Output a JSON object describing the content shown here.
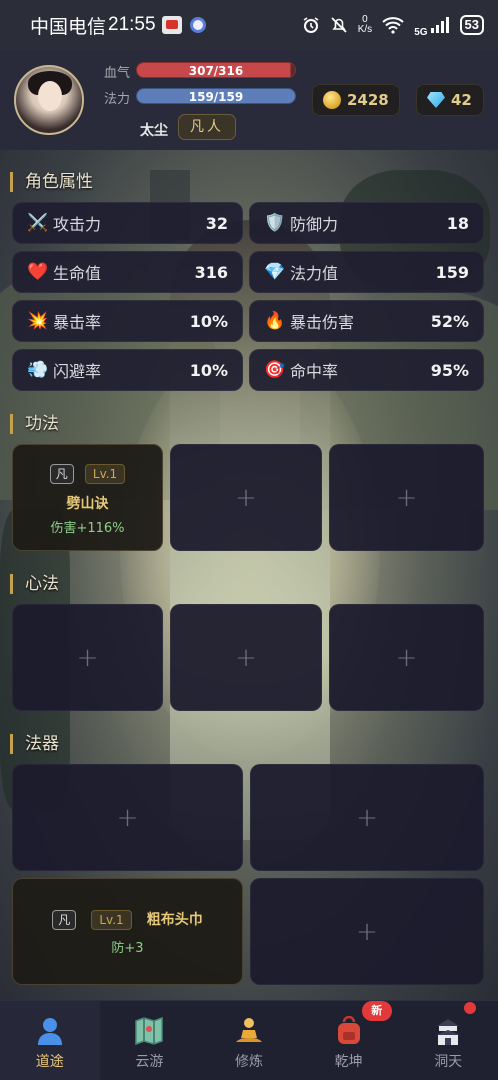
{
  "status_bar": {
    "carrier": "中国电信",
    "time": "21:55",
    "net_speed_value": "0",
    "net_speed_unit": "K/s",
    "signal_type": "5G",
    "battery": "53"
  },
  "header": {
    "hp_label": "血气",
    "hp_value": "307/316",
    "hp_fraction": 0.9715,
    "mp_label": "法力",
    "mp_value": "159/159",
    "mp_fraction": 1.0,
    "player_name": "太尘",
    "rank": "凡人",
    "gold": "2428",
    "gems": "42"
  },
  "attributes": {
    "title": "角色属性",
    "items": [
      {
        "icon": "⚔️",
        "icon_name": "swords-icon",
        "label": "攻击力",
        "value": "32"
      },
      {
        "icon": "🛡️",
        "icon_name": "shield-icon",
        "label": "防御力",
        "value": "18"
      },
      {
        "icon": "❤️",
        "icon_name": "heart-icon",
        "label": "生命值",
        "value": "316"
      },
      {
        "icon": "💎",
        "icon_name": "diamond-icon",
        "label": "法力值",
        "value": "159"
      },
      {
        "icon": "💥",
        "icon_name": "explosion-icon",
        "label": "暴击率",
        "value": "10%"
      },
      {
        "icon": "🔥",
        "icon_name": "fire-icon",
        "label": "暴击伤害",
        "value": "52%"
      },
      {
        "icon": "💨",
        "icon_name": "wind-icon",
        "label": "闪避率",
        "value": "10%"
      },
      {
        "icon": "🎯",
        "icon_name": "target-icon",
        "label": "命中率",
        "value": "95%"
      }
    ]
  },
  "skills": {
    "title": "功法",
    "slot1": {
      "grade": "凡",
      "level": "Lv.1",
      "name": "劈山诀",
      "effect": "伤害+116%"
    }
  },
  "mind": {
    "title": "心法"
  },
  "artifacts": {
    "title": "法器",
    "slot3": {
      "grade": "凡",
      "level": "Lv.1",
      "name": "粗布头巾",
      "effect": "防+3"
    }
  },
  "plus_symbol": "+",
  "nav": {
    "items": [
      {
        "label": "道途",
        "icon_name": "person-icon",
        "active": true
      },
      {
        "label": "云游",
        "icon_name": "map-icon",
        "active": false
      },
      {
        "label": "修炼",
        "icon_name": "meditation-icon",
        "active": false
      },
      {
        "label": "乾坤",
        "icon_name": "backpack-icon",
        "active": false
      },
      {
        "label": "洞天",
        "icon_name": "castle-icon",
        "active": false
      }
    ],
    "new_badge": "新"
  },
  "colors": {
    "accent_gold": "#e6c978",
    "hp_bar": "#c7484a",
    "mp_bar": "#5d7eb8",
    "effect_green": "#8ecf8a"
  }
}
